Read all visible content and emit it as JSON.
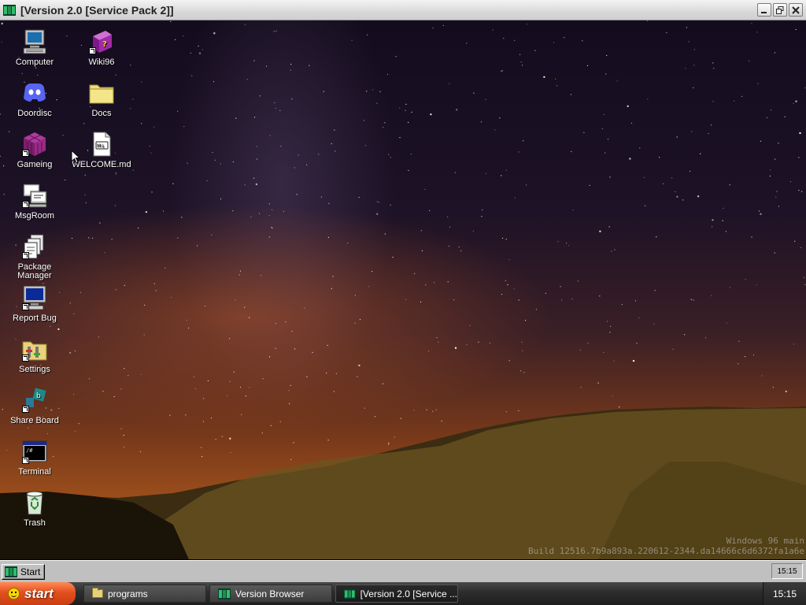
{
  "window": {
    "title": "[Version 2.0 [Service Pack 2]]",
    "icon": "windows96-app-icon"
  },
  "desktop": {
    "icons": [
      {
        "label": "Computer",
        "icon": "computer-icon",
        "shortcut": false
      },
      {
        "label": "Doordisc",
        "icon": "discord-icon",
        "shortcut": false
      },
      {
        "label": "Gameing",
        "icon": "cube-icon",
        "shortcut": true
      },
      {
        "label": "MsgRoom",
        "icon": "chat-computer-icon",
        "shortcut": true
      },
      {
        "label": "Package Manager",
        "icon": "package-icon",
        "shortcut": true
      },
      {
        "label": "Report Bug",
        "icon": "monitor-bug-icon",
        "shortcut": true
      },
      {
        "label": "Settings",
        "icon": "settings-folder-icon",
        "shortcut": true
      },
      {
        "label": "Share Board",
        "icon": "share-board-icon",
        "shortcut": true
      },
      {
        "label": "Terminal",
        "icon": "terminal-icon",
        "shortcut": true
      },
      {
        "label": "Trash",
        "icon": "recycle-bin-icon",
        "shortcut": false
      },
      {
        "label": "Wiki96",
        "icon": "book-icon",
        "shortcut": true
      },
      {
        "label": "Docs",
        "icon": "folder-icon",
        "shortcut": false
      },
      {
        "label": "WELCOME.md",
        "icon": "markdown-file-icon",
        "shortcut": false
      }
    ],
    "watermark": {
      "line1": "Windows 96 main",
      "line2": "Build 12516.7b9a893a.220612-2344.da14666c6d6372fa1a6e"
    }
  },
  "w96_taskbar": {
    "start_label": "Start",
    "clock": "15:15"
  },
  "xp_taskbar": {
    "start_label": "start",
    "tasks": [
      {
        "label": "programs",
        "icon": "folder-icon"
      },
      {
        "label": "Version Browser",
        "icon": "windows96-app-icon"
      },
      {
        "label": "[Version 2.0 [Service ...",
        "icon": "windows96-app-icon"
      }
    ],
    "clock": "15:15"
  }
}
